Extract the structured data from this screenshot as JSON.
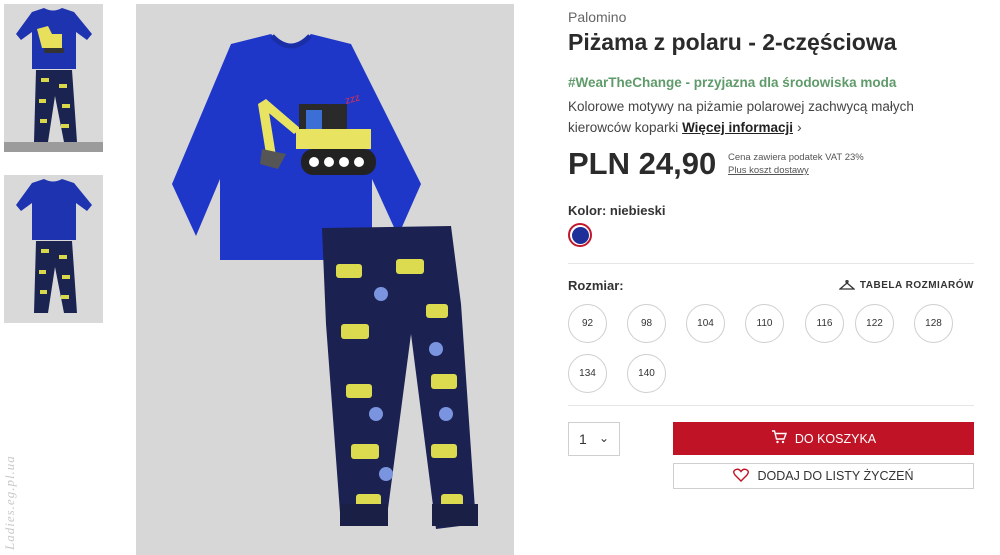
{
  "product": {
    "brand": "Palomino",
    "title": "Piżama z polaru - 2-częściowa",
    "eco_tag": "#WearTheChange - przyjazna dla środowiska moda",
    "description": "Kolorowe motywy na piżamie polarowej zachwycą małych kierowców koparki",
    "more_info": "Więcej informacji",
    "price": "PLN 24,90",
    "vat_note": "Cena zawiera podatek VAT 23%",
    "shipping_link": "Plus koszt dostawy"
  },
  "color": {
    "label": "Kolor: niebieski",
    "swatch_hex": "#1f2f9a",
    "selected_ring_hex": "#c0172d"
  },
  "size": {
    "label": "Rozmiar:",
    "table_link": "TABELA ROZMIARÓW",
    "options": [
      "92",
      "98",
      "104",
      "110",
      "116",
      "122",
      "128",
      "134",
      "140"
    ]
  },
  "purchase": {
    "quantity": "1",
    "add_to_cart": "DO KOSZYKA",
    "add_to_wishlist": "DODAJ DO LISTY ŻYCZEŃ",
    "accent_hex": "#c01326"
  },
  "watermark": "Ladies.eg.pl.ua"
}
